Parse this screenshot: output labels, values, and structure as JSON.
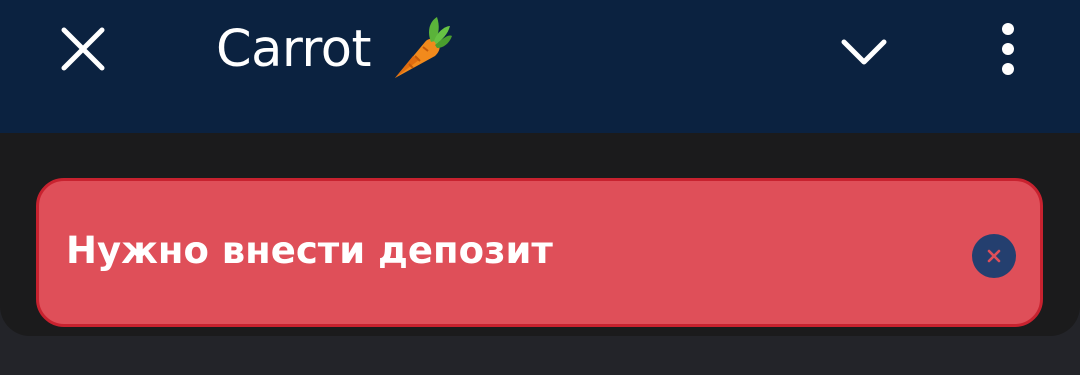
{
  "app_bar": {
    "title": "Carrot",
    "title_emoji": "carrot-icon",
    "close_icon": "close-icon",
    "collapse_icon": "chevron-down-icon",
    "more_icon": "more-vertical-icon"
  },
  "alert": {
    "message": "Нужно внести депозит",
    "dismiss_icon": "close-icon"
  },
  "colors": {
    "app_bar_bg": "#0b2240",
    "strip_bg": "#1b1b1c",
    "page_bg": "#232429",
    "alert_bg": "#df4f59",
    "alert_border": "#c8222f",
    "alert_close_bg": "#243f6f",
    "alert_close_x": "#df4f59",
    "text": "#ffffff"
  }
}
